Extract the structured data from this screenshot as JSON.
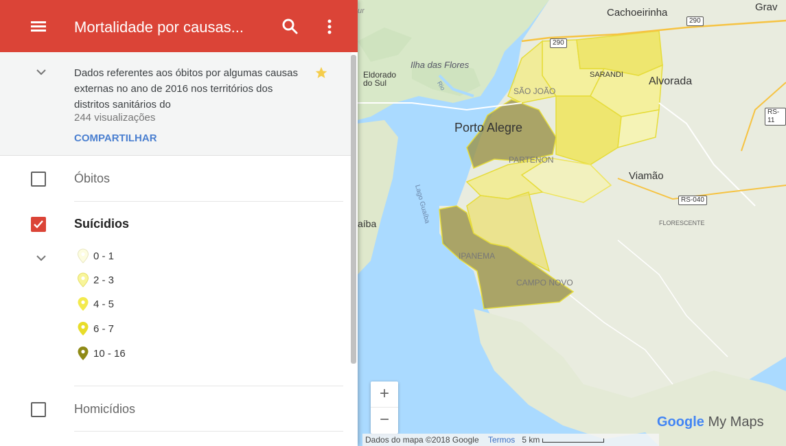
{
  "header": {
    "title": "Mortalidade por causas..."
  },
  "info": {
    "description": "Dados referentes aos óbitos por algumas causas externas no ano de 2016 nos territórios dos distritos sanitários do",
    "views": "244 visualizações",
    "share_label": "COMPARTILHAR"
  },
  "layers": [
    {
      "name": "Óbitos",
      "checked": false
    },
    {
      "name": "Suícidios",
      "checked": true
    },
    {
      "name": "Homicídios",
      "checked": false
    }
  ],
  "legend": [
    {
      "label": "0 - 1",
      "color": "#fdfde0"
    },
    {
      "label": "2 - 3",
      "color": "#f8f59a"
    },
    {
      "label": "4 - 5",
      "color": "#f3ea4e"
    },
    {
      "label": "6 - 7",
      "color": "#e8dd2a"
    },
    {
      "label": "10 - 16",
      "color": "#8f8a16"
    }
  ],
  "map": {
    "places": {
      "cachoeirinha": "Cachoeirinha",
      "grav": "Grav",
      "ilha_das_flores": "Ilha das Flores",
      "eldorado": "Eldorado",
      "do_sul": "do Sul",
      "sarandi": "SARANDI",
      "alvorada": "Alvorada",
      "sao_joao": "SÃO JOÃO",
      "porto_alegre": "Porto Alegre",
      "partenon": "PARTENON",
      "viamao": "Viamão",
      "florescente": "FLORESCENTE",
      "guaiba": "aíba",
      "lago_guaiba": "Lago Guaíba",
      "ipanema": "IPANEMA",
      "campo_novo": "CAMPO NOVO",
      "rio": "Rio",
      "rua": "ur"
    },
    "shields": {
      "br290_top": "290",
      "br290_right": "290",
      "rs040": "RS-040",
      "rs11": "RS-11"
    },
    "zoom_in": "+",
    "zoom_out": "−",
    "attribution": "Dados do mapa ©2018 Google",
    "terms": "Termos",
    "scale": "5 km",
    "brand_g": "Google",
    "brand_rest": "My Maps"
  },
  "colors": {
    "header": "#db4437",
    "water": "#aadaff",
    "land": "#e9ecdf",
    "share_link": "#4a7fd0"
  }
}
